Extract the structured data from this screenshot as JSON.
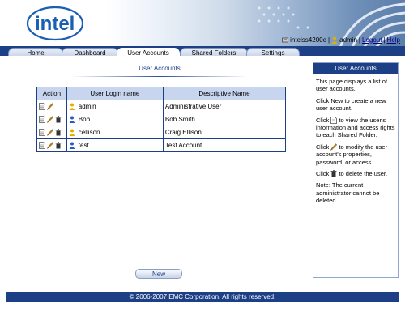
{
  "header": {
    "logo_text": "intel",
    "device_name": "intelss4200e",
    "user": "admin",
    "logout_label": "Logout",
    "help_label": "Help",
    "separator": "|"
  },
  "tabs": [
    {
      "label": "Home"
    },
    {
      "label": "Dashboard"
    },
    {
      "label": "User Accounts",
      "active": true
    },
    {
      "label": "Shared Folders"
    },
    {
      "label": "Settings"
    }
  ],
  "main": {
    "title": "User Accounts",
    "columns": [
      "Action",
      "User Login name",
      "Descriptive Name"
    ],
    "rows": [
      {
        "login": "admin",
        "description": "Administrative User",
        "icon": "user-admin-icon",
        "deletable": false
      },
      {
        "login": "Bob",
        "description": "Bob Smith",
        "icon": "user-icon",
        "deletable": true
      },
      {
        "login": "cellison",
        "description": "Craig Ellison",
        "icon": "user-admin-icon",
        "deletable": true
      },
      {
        "login": "test",
        "description": "Test Account",
        "icon": "user-icon",
        "deletable": true
      }
    ],
    "new_button": "New"
  },
  "sidebar": {
    "title": "User Accounts",
    "p1": "This page displays a list of user accounts.",
    "p2": "Click New to create a new user account.",
    "p3_pre": "Click",
    "p3_post": "to view the user's information and access rights to each Shared Folder.",
    "p4_pre": "Click",
    "p4_post": "to modify the user account's properties, password, or access.",
    "p5_pre": "Click",
    "p5_post": "to delete the user.",
    "p6": "Note: The current administrator cannot be deleted."
  },
  "footer": {
    "text": "© 2006-2007 EMC Corporation. All rights reserved."
  },
  "colors": {
    "navy": "#1d3f85",
    "table_header": "#c7d5ef",
    "admin_user": "#e0b000",
    "normal_user": "#2f56c7"
  }
}
